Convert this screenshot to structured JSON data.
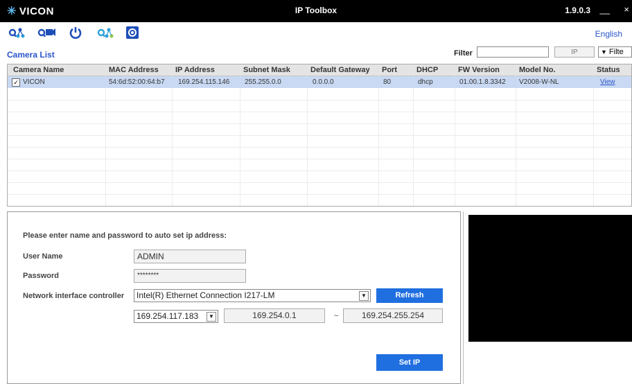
{
  "window": {
    "logo_text": "VICON",
    "title": "IP Toolbox",
    "version": "1.9.0.3",
    "minimize": "__",
    "close": "×"
  },
  "toolbar": {
    "icons": [
      "search-network-icon",
      "search-camera-icon",
      "reboot-icon",
      "network-settings-icon",
      "firmware-update-icon"
    ],
    "language": "English"
  },
  "camera_list": {
    "label": "Camera List",
    "filter_label": "Filter",
    "filter_value": "",
    "filter_ip_placeholder": "IP",
    "filter_dropdown": "Filte",
    "columns": [
      "Camera Name",
      "MAC Address",
      "IP Address",
      "Subnet Mask",
      "Default Gateway",
      "Port",
      "DHCP",
      "FW Version",
      "Model No.",
      "Status"
    ],
    "rows": [
      {
        "checked": true,
        "camera_name": "VICON",
        "mac": "54:6d:52:00:64:b7",
        "ip": "169.254.115.146",
        "subnet": "255.255.0.0",
        "gateway": "0.0.0.0",
        "port": "80",
        "dhcp": "dhcp",
        "fw": "01.00.1.8.3342",
        "model": "V2008-W-NL",
        "status": "View"
      }
    ]
  },
  "auto_ip": {
    "prompt": "Please enter name and password to auto set ip address:",
    "user_label": "User Name",
    "user_value": "ADMIN",
    "password_label": "Password",
    "password_value": "********",
    "nic_label": "Network interface controller",
    "nic_value": "Intel(R) Ethernet Connection I217-LM",
    "refresh_label": "Refresh",
    "local_ip": "169.254.117.183",
    "range_start": "169.254.0.1",
    "range_sep": "~",
    "range_end": "169.254.255.254",
    "set_ip_label": "Set IP"
  },
  "colors": {
    "titlebar": "#000000",
    "accent_blue": "#2a54c9",
    "button_blue": "#1f6fe0",
    "selected_row": "#c9d9f3",
    "preview": "#000000"
  }
}
